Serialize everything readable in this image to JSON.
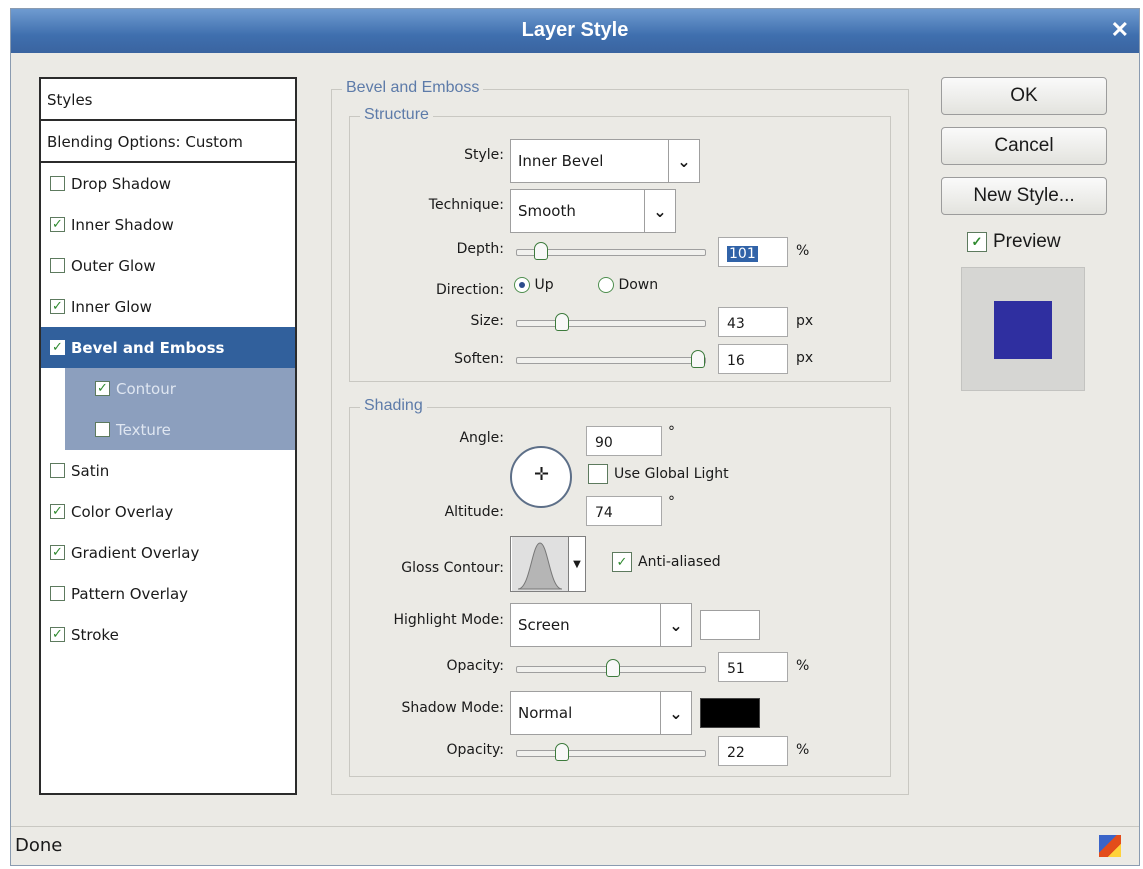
{
  "window": {
    "title": "Layer Style"
  },
  "styles_list": {
    "header": "Styles",
    "blending": "Blending Options: Custom",
    "items": [
      {
        "label": "Drop Shadow",
        "checked": false
      },
      {
        "label": "Inner Shadow",
        "checked": true
      },
      {
        "label": "Outer Glow",
        "checked": false
      },
      {
        "label": "Inner Glow",
        "checked": true
      },
      {
        "label": "Bevel and Emboss",
        "checked": true,
        "selected": true
      },
      {
        "label": "Contour",
        "checked": true,
        "sub": true
      },
      {
        "label": "Texture",
        "checked": false,
        "sub": true
      },
      {
        "label": "Satin",
        "checked": false
      },
      {
        "label": "Color Overlay",
        "checked": true
      },
      {
        "label": "Gradient Overlay",
        "checked": true
      },
      {
        "label": "Pattern Overlay",
        "checked": false
      },
      {
        "label": "Stroke",
        "checked": true
      }
    ]
  },
  "bevel": {
    "title": "Bevel and Emboss",
    "structure": {
      "title": "Structure",
      "style_label": "Style:",
      "style_value": "Inner Bevel",
      "technique_label": "Technique:",
      "technique_value": "Smooth",
      "depth_label": "Depth:",
      "depth_value": "101",
      "depth_unit": "%",
      "depth_slider_fraction": 0.1,
      "direction_label": "Direction:",
      "direction_up": "Up",
      "direction_down": "Down",
      "direction_selected": "Up",
      "size_label": "Size:",
      "size_value": "43",
      "size_unit": "px",
      "size_slider_fraction": 0.22,
      "soften_label": "Soften:",
      "soften_value": "16",
      "soften_unit": "px",
      "soften_slider_fraction": 1.0
    },
    "shading": {
      "title": "Shading",
      "angle_label": "Angle:",
      "angle_value": "90",
      "angle_unit": "°",
      "use_global_light": "Use Global Light",
      "use_global_light_checked": false,
      "altitude_label": "Altitude:",
      "altitude_value": "74",
      "altitude_unit": "°",
      "gloss_label": "Gloss Contour:",
      "anti_aliased": "Anti-aliased",
      "anti_aliased_checked": true,
      "highlight_label": "Highlight Mode:",
      "highlight_value": "Screen",
      "highlight_color": "#ffffff",
      "opacity_label": "Opacity:",
      "highlight_opacity": "51",
      "highlight_opacity_fraction": 0.51,
      "opacity_unit": "%",
      "shadow_label": "Shadow Mode:",
      "shadow_value": "Normal",
      "shadow_color": "#000000",
      "shadow_opacity": "22",
      "shadow_opacity_fraction": 0.22
    }
  },
  "buttons": {
    "ok": "OK",
    "cancel": "Cancel",
    "new_style": "New Style...",
    "preview": "Preview",
    "preview_checked": true,
    "preview_swatch": "#2f2fa0"
  },
  "status": {
    "text": "Done"
  }
}
